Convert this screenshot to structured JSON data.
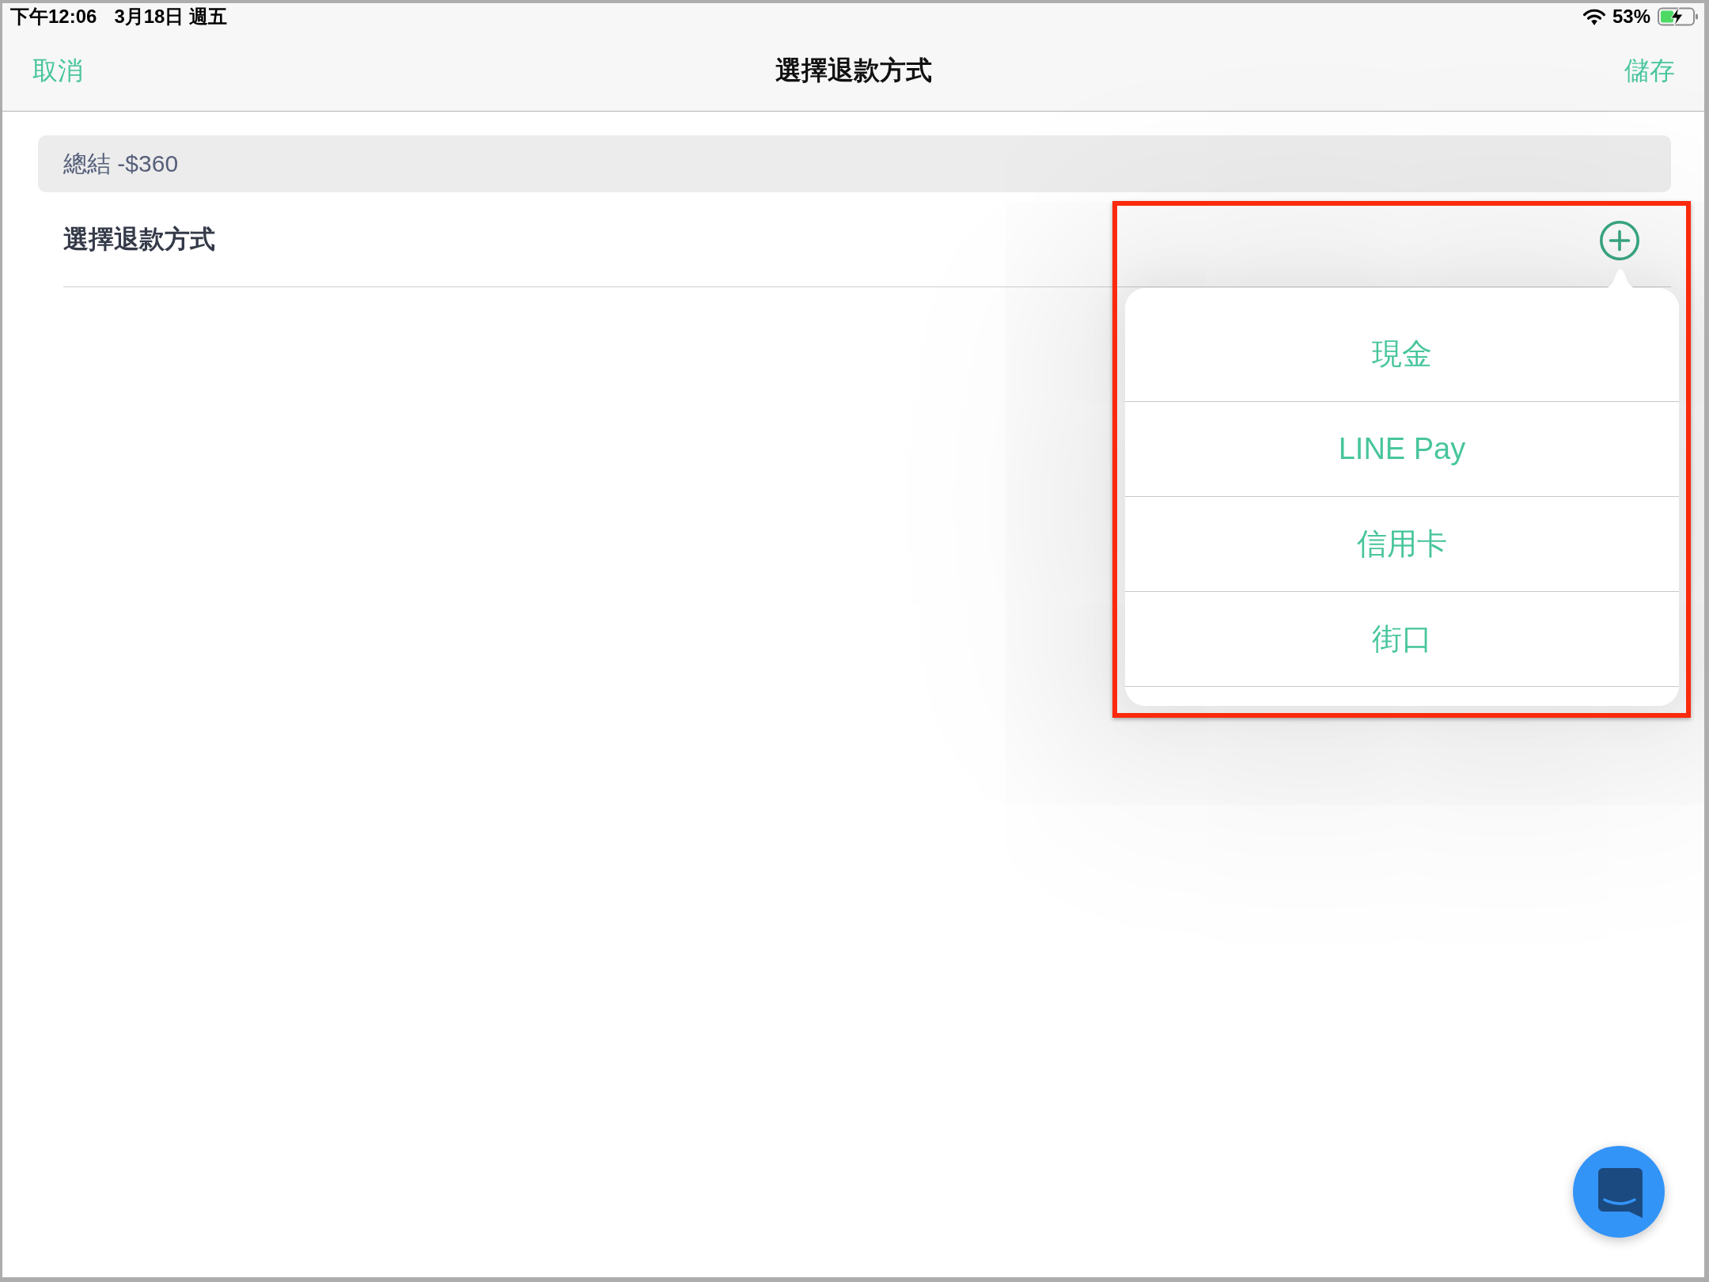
{
  "status_bar": {
    "time": "下午12:06",
    "date": "3月18日 週五",
    "battery_percent": "53%"
  },
  "nav_bar": {
    "cancel": "取消",
    "title": "選擇退款方式",
    "save": "儲存"
  },
  "summary": {
    "label": "總結 -$360"
  },
  "refund_method_row": {
    "title": "選擇退款方式"
  },
  "popover": {
    "highlighted": true,
    "items": [
      {
        "label": "現金"
      },
      {
        "label": "LINE Pay"
      },
      {
        "label": "信用卡"
      },
      {
        "label": "街口"
      }
    ]
  }
}
